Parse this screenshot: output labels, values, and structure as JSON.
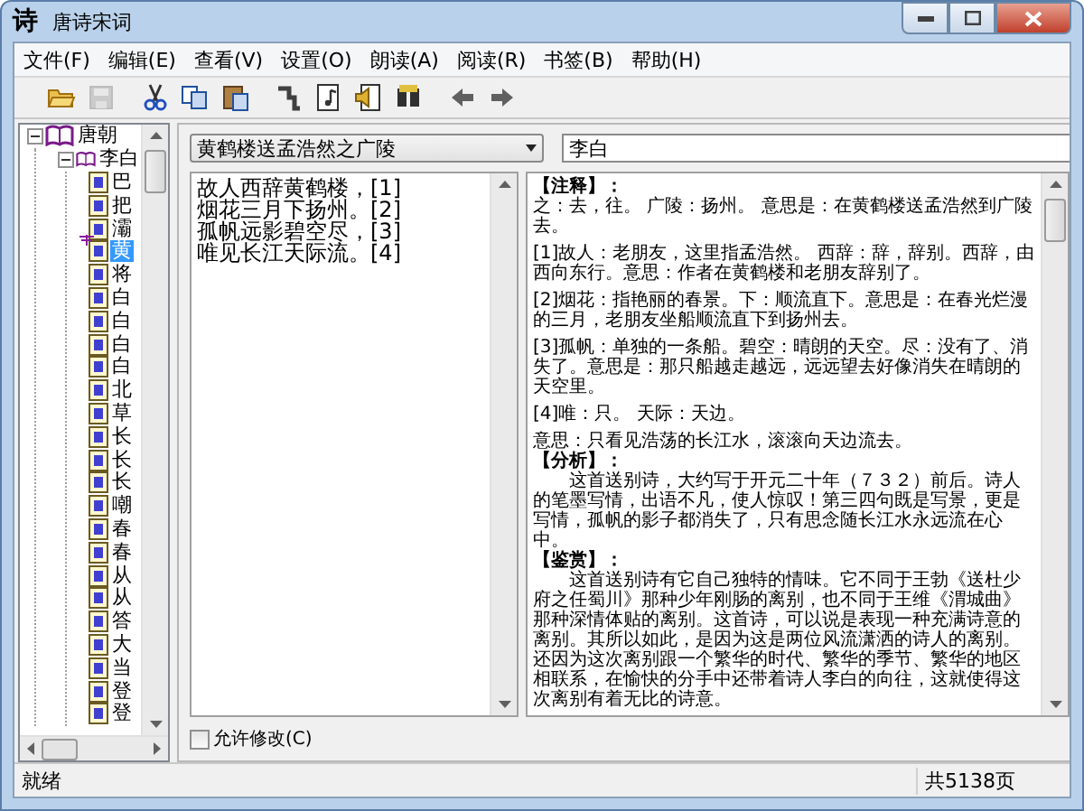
{
  "window": {
    "icon_glyph": "诗",
    "title": "唐诗宋词"
  },
  "menu": [
    "文件(F)",
    "编辑(E)",
    "查看(V)",
    "设置(O)",
    "朗读(A)",
    "阅读(R)",
    "书签(B)",
    "帮助(H)"
  ],
  "toolbar": [
    {
      "kind": "open",
      "disabled": false
    },
    {
      "kind": "save",
      "disabled": true
    },
    {
      "kind": "cut",
      "disabled": false
    },
    {
      "kind": "copy",
      "disabled": false
    },
    {
      "kind": "paste",
      "disabled": false
    },
    {
      "kind": "step",
      "disabled": false
    },
    {
      "kind": "music",
      "disabled": false
    },
    {
      "kind": "speak",
      "disabled": false
    },
    {
      "kind": "find",
      "disabled": false
    },
    {
      "kind": "back",
      "disabled": false
    },
    {
      "kind": "forward",
      "disabled": false
    }
  ],
  "tree": [
    {
      "label": "唐朝",
      "expanded": true,
      "children": [
        {
          "label": "李白",
          "expanded": true,
          "children": [
            {
              "label": "巴",
              "selected": false,
              "bookmarked": false
            },
            {
              "label": "把",
              "selected": false,
              "bookmarked": false
            },
            {
              "label": "灞",
              "selected": false,
              "bookmarked": false
            },
            {
              "label": "黄",
              "selected": true,
              "bookmarked": true
            },
            {
              "label": "将",
              "selected": false,
              "bookmarked": false
            },
            {
              "label": "白",
              "selected": false,
              "bookmarked": false
            },
            {
              "label": "白",
              "selected": false,
              "bookmarked": false
            },
            {
              "label": "白",
              "selected": false,
              "bookmarked": false
            },
            {
              "label": "白",
              "selected": false,
              "bookmarked": false
            },
            {
              "label": "北",
              "selected": false,
              "bookmarked": false
            },
            {
              "label": "草",
              "selected": false,
              "bookmarked": false
            },
            {
              "label": "长",
              "selected": false,
              "bookmarked": false
            },
            {
              "label": "长",
              "selected": false,
              "bookmarked": false
            },
            {
              "label": "长",
              "selected": false,
              "bookmarked": false
            },
            {
              "label": "嘲",
              "selected": false,
              "bookmarked": false
            },
            {
              "label": "春",
              "selected": false,
              "bookmarked": false
            },
            {
              "label": "春",
              "selected": false,
              "bookmarked": false
            },
            {
              "label": "从",
              "selected": false,
              "bookmarked": false
            },
            {
              "label": "从",
              "selected": false,
              "bookmarked": false
            },
            {
              "label": "答",
              "selected": false,
              "bookmarked": false
            },
            {
              "label": "大",
              "selected": false,
              "bookmarked": false
            },
            {
              "label": "当",
              "selected": false,
              "bookmarked": false
            },
            {
              "label": "登",
              "selected": false,
              "bookmarked": false
            },
            {
              "label": "登",
              "selected": false,
              "bookmarked": false
            }
          ]
        }
      ]
    }
  ],
  "title_combo": {
    "value": "黄鹤楼送孟浩然之广陵"
  },
  "author_field": {
    "value": "李白"
  },
  "poem_lines": [
    "故人西辞黄鹤楼，[1]",
    "烟花三月下扬州。[2]",
    "孤帆远影碧空尽，[3]",
    "唯见长江天际流。[4]"
  ],
  "notes": [
    {
      "kind": "heading",
      "text": "【注释】："
    },
    {
      "kind": "body",
      "text": "之：去，往。 广陵：扬州。 意思是：在黄鹤楼送孟浩然到广陵去。"
    },
    {
      "kind": "body",
      "text": "[1]故人：老朋友，这里指孟浩然。 西辞：辞，辞别。西辞，由西向东行。意思：作者在黄鹤楼和老朋友辞别了。"
    },
    {
      "kind": "body",
      "text": "[2]烟花：指艳丽的春景。下：顺流直下。意思是：在春光烂漫的三月，老朋友坐船顺流直下到扬州去。"
    },
    {
      "kind": "body",
      "text": "[3]孤帆：单独的一条船。碧空：晴朗的天空。尽：没有了、消失了。意思是：那只船越走越远，远远望去好像消失在晴朗的天空里。"
    },
    {
      "kind": "body",
      "text": "[4]唯：只。 天际：天边。"
    },
    {
      "kind": "line",
      "text": "意思：只看见浩荡的长江水，滚滚向天边流去。"
    },
    {
      "kind": "heading",
      "text": "【分析】："
    },
    {
      "kind": "line",
      "text": "　　这首送别诗，大约写于开元二十年（７３２）前后。诗人的笔墨写情，出语不凡，使人惊叹！第三四句既是写景，更是写情，孤帆的影子都消失了，只有思念随长江水永远流在心中。"
    },
    {
      "kind": "heading",
      "text": "【鉴赏】："
    },
    {
      "kind": "line",
      "text": "　　这首送别诗有它自己独特的情味。它不同于王勃《送杜少府之任蜀川》那种少年刚肠的离别，也不同于王维《渭城曲》那种深情体贴的离别。这首诗，可以说是表现一种充满诗意的离别。其所以如此，是因为这是两位风流潇洒的诗人的离别。还因为这次离别跟一个繁华的时代、繁华的季节、繁华的地区相联系，在愉快的分手中还带着诗人李白的向往，这就使得这次离别有着无比的诗意。"
    }
  ],
  "allow_edit": {
    "label": "允许修改(C)",
    "checked": false
  },
  "status_bar": {
    "left": "就绪",
    "right": "共5138页"
  }
}
